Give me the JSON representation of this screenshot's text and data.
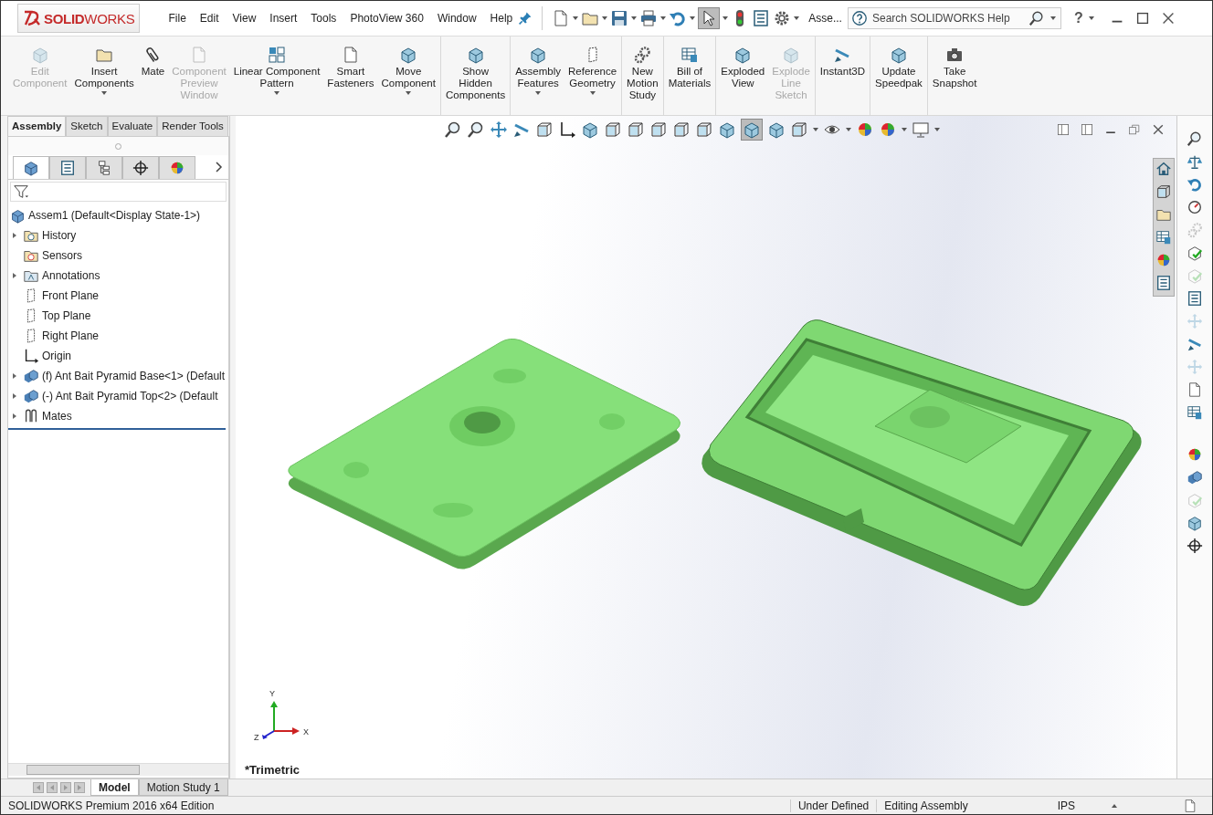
{
  "logo": {
    "text": "**SOLID**WORKS"
  },
  "menu": [
    "File",
    "Edit",
    "View",
    "Insert",
    "Tools",
    "PhotoView 360",
    "Window",
    "Help"
  ],
  "document_title": "Asse...",
  "search": {
    "placeholder": "Search SOLIDWORKS Help"
  },
  "help": "?",
  "ribbon_groups": [
    [
      {
        "label": "Edit\nComponent",
        "kind": "cube",
        "disabled": true,
        "dropdown": false
      },
      {
        "label": "Insert\nComponents",
        "kind": "folder",
        "disabled": false,
        "dropdown": true
      },
      {
        "label": "Mate",
        "kind": "clip",
        "disabled": false,
        "dropdown": false
      },
      {
        "label": "Component\nPreview\nWindow",
        "kind": "page",
        "disabled": true,
        "dropdown": false
      },
      {
        "label": "Linear Component\nPattern",
        "kind": "grid",
        "disabled": false,
        "dropdown": true
      },
      {
        "label": "Smart\nFasteners",
        "kind": "page",
        "disabled": false,
        "dropdown": false
      },
      {
        "label": "Move\nComponent",
        "kind": "cube",
        "disabled": false,
        "dropdown": true
      }
    ],
    [
      {
        "label": "Show\nHidden\nComponents",
        "kind": "cube",
        "disabled": false,
        "dropdown": false
      }
    ],
    [
      {
        "label": "Assembly\nFeatures",
        "kind": "cube",
        "disabled": false,
        "dropdown": true
      },
      {
        "label": "Reference\nGeometry",
        "kind": "plane",
        "disabled": false,
        "dropdown": true
      }
    ],
    [
      {
        "label": "New\nMotion\nStudy",
        "kind": "gears",
        "disabled": false,
        "dropdown": false
      }
    ],
    [
      {
        "label": "Bill of\nMaterials",
        "kind": "table",
        "disabled": false,
        "dropdown": false
      }
    ],
    [
      {
        "label": "Exploded\nView",
        "kind": "cube",
        "disabled": false,
        "dropdown": false
      },
      {
        "label": "Explode\nLine\nSketch",
        "kind": "cube",
        "disabled": true,
        "dropdown": false
      }
    ],
    [
      {
        "label": "Instant3D",
        "kind": "ruler",
        "disabled": false,
        "dropdown": false
      }
    ],
    [
      {
        "label": "Update\nSpeedpak",
        "kind": "cube",
        "disabled": false,
        "dropdown": false
      }
    ],
    [
      {
        "label": "Take\nSnapshot",
        "kind": "camera",
        "disabled": false,
        "dropdown": false
      }
    ]
  ],
  "tabs": [
    {
      "label": "Assembly",
      "selected": true
    },
    {
      "label": "Sketch",
      "selected": false
    },
    {
      "label": "Evaluate",
      "selected": false
    },
    {
      "label": "Render Tools",
      "selected": false
    }
  ],
  "panel_tabs": [
    {
      "kind": "tree",
      "selected": true
    },
    {
      "kind": "list",
      "selected": false
    },
    {
      "kind": "config",
      "selected": false
    },
    {
      "kind": "crosshair",
      "selected": false
    },
    {
      "kind": "ball",
      "selected": false
    }
  ],
  "tree": {
    "root": "Assem1  (Default<Display State-1>)",
    "items": [
      {
        "label": "History",
        "kind": "history",
        "has_children": true
      },
      {
        "label": "Sensors",
        "kind": "sensor",
        "has_children": false
      },
      {
        "label": "Annotations",
        "kind": "annotation",
        "has_children": true
      },
      {
        "label": "Front Plane",
        "kind": "plane",
        "has_children": false
      },
      {
        "label": "Top Plane",
        "kind": "plane",
        "has_children": false
      },
      {
        "label": "Right Plane",
        "kind": "plane",
        "has_children": false
      },
      {
        "label": "Origin",
        "kind": "origin",
        "has_children": false
      },
      {
        "label": "(f) Ant Bait Pyramid Base<1> (Default",
        "kind": "part",
        "has_children": true
      },
      {
        "label": "(-) Ant Bait Pyramid Top<2> (Default",
        "kind": "part",
        "has_children": true
      },
      {
        "label": "Mates",
        "kind": "mates",
        "has_children": true
      }
    ]
  },
  "triad": {
    "x": "X",
    "y": "Y",
    "z": "Z"
  },
  "view_label": "*Trimetric",
  "bottom_tabs": [
    {
      "label": "Model",
      "selected": true
    },
    {
      "label": "Motion Study 1",
      "selected": false
    }
  ],
  "status_bar": {
    "edition": "SOLIDWORKS Premium 2016 x64 Edition",
    "state": "Under Defined",
    "mode": "Editing Assembly",
    "units": "IPS"
  }
}
